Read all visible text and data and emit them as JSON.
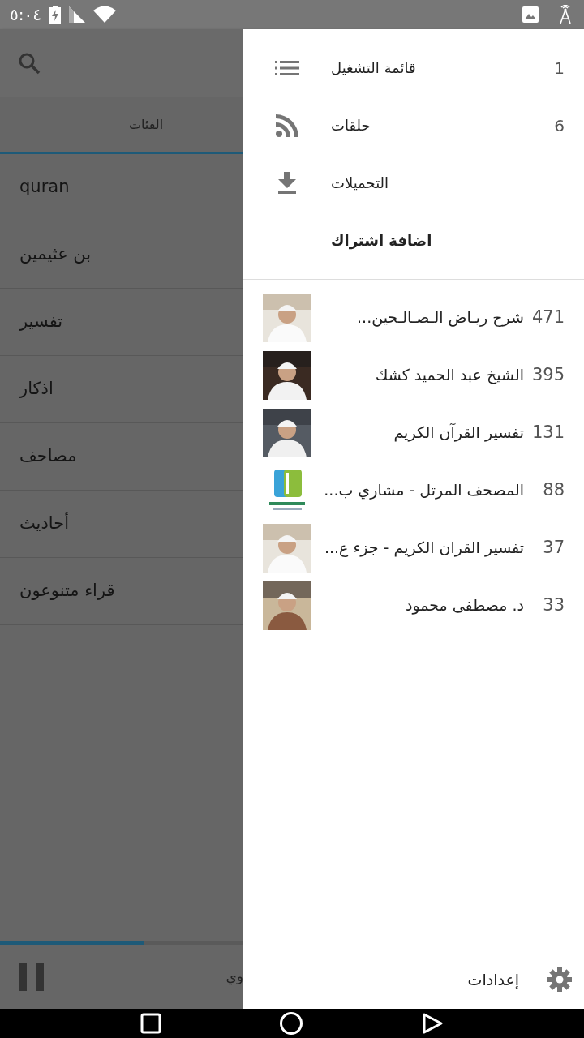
{
  "status_bar": {
    "time": "٥:٠٤"
  },
  "tabs": [
    {
      "label": "الفئات",
      "selected": true
    }
  ],
  "categories": [
    {
      "label": "quran"
    },
    {
      "label": "بن عثيمين"
    },
    {
      "label": "تفسير"
    },
    {
      "label": "اذكار"
    },
    {
      "label": "مصاحف"
    },
    {
      "label": "أحاديث"
    },
    {
      "label": "قراء متنوعون"
    }
  ],
  "player": {
    "title": "وي",
    "level": 0.247
  },
  "drawer": {
    "menu": [
      {
        "kind": "playlist",
        "label": "قائمة التشغيل",
        "count": "1"
      },
      {
        "kind": "episodes",
        "label": "حلقات",
        "count": "6"
      },
      {
        "kind": "downloads",
        "label": "التحميلات"
      },
      {
        "kind": "add",
        "label": "اضافة اشتراك"
      }
    ],
    "subscriptions": [
      {
        "count": "471",
        "title": "شرح ريـاض الـصـالـحين..."
      },
      {
        "count": "395",
        "title": "الشيخ عبد الحميد كشك"
      },
      {
        "count": "131",
        "title": "تفسير القرآن الكريم"
      },
      {
        "count": "88",
        "title": "المصحف المرتل - مشاري ب..."
      },
      {
        "count": "37",
        "title": "تفسير القران الكريم - جزء ع..."
      },
      {
        "count": "33",
        "title": "د. مصطفى محمود"
      }
    ],
    "settings": {
      "label": "إعدادات"
    }
  }
}
